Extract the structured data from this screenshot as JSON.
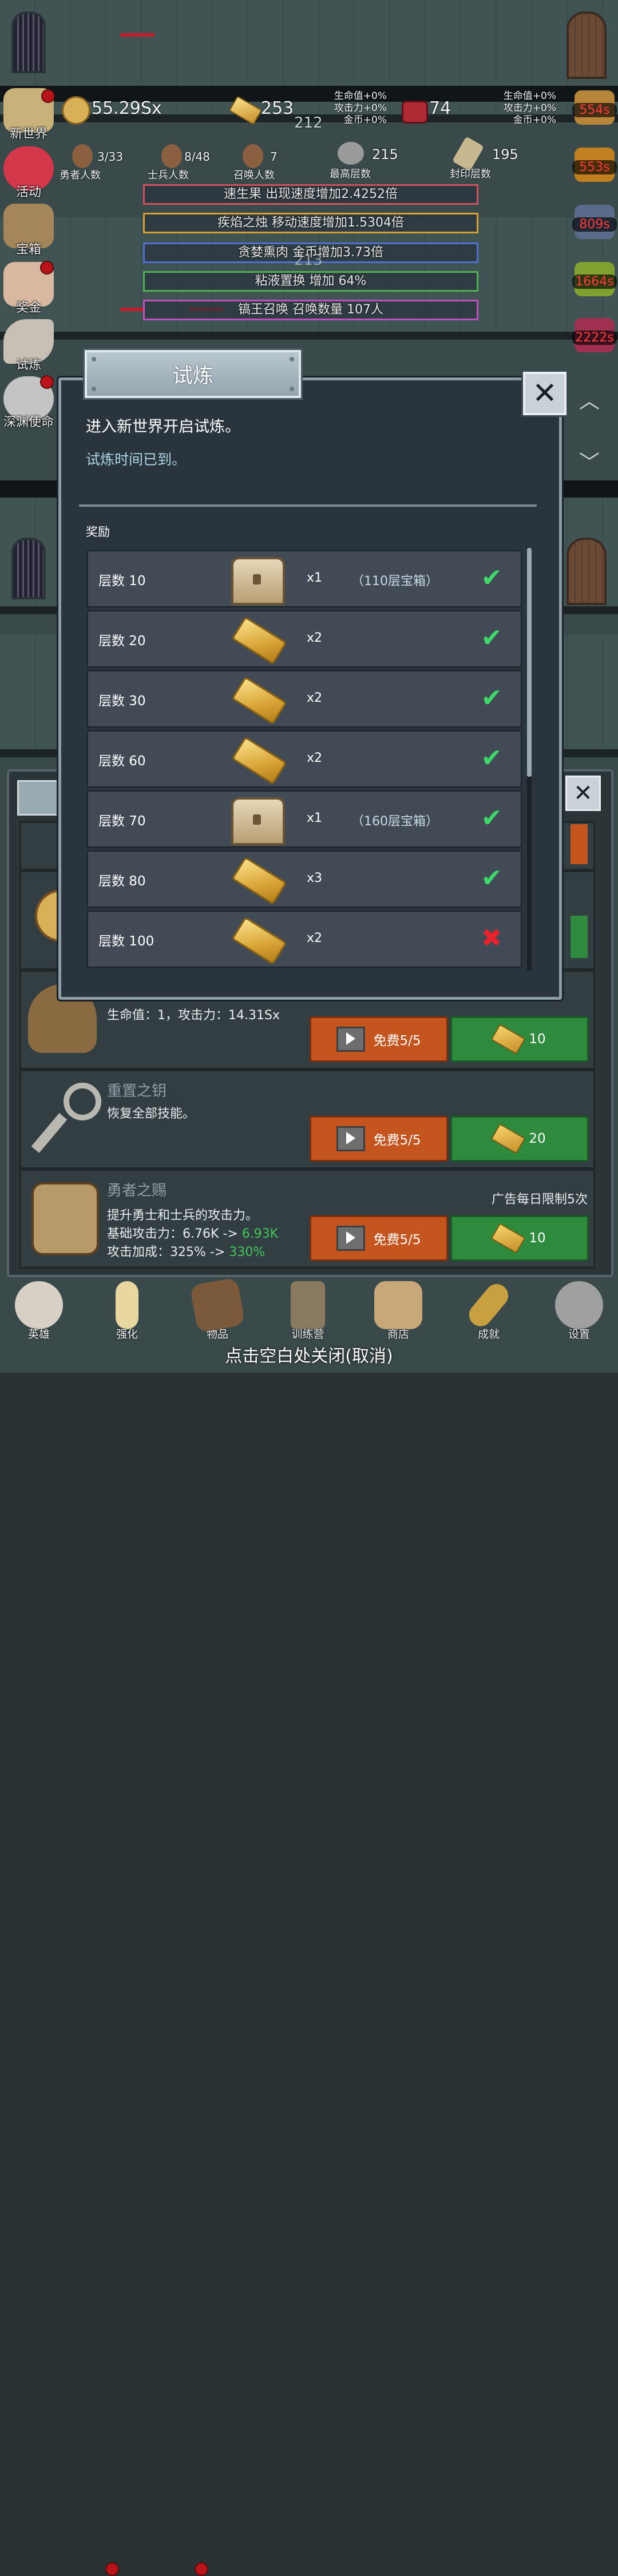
{
  "resources": {
    "coins": "55.29Sx",
    "gold_bars": "253",
    "gold_sub": "212",
    "gems": "74",
    "left_bonus": [
      "生命值+0%",
      "攻击力+0%",
      "金币+0%"
    ],
    "right_bonus": [
      "生命值+0%",
      "攻击力+0%",
      "金币+0%"
    ]
  },
  "stats": [
    {
      "value": "3/33",
      "label": "勇者人数"
    },
    {
      "value": "8/48",
      "label": "士兵人数"
    },
    {
      "value": "7",
      "label": "召唤人数"
    },
    {
      "value": "215",
      "label": "最高层数"
    },
    {
      "value": "195",
      "label": "封印层数"
    }
  ],
  "buffs": [
    {
      "text": "速生果 出现速度增加2.4252倍",
      "color": "#d05060"
    },
    {
      "text": "疾焰之烛 移动速度增加1.5304倍",
      "color": "#d8a030"
    },
    {
      "text": "贪婪熏肉 金币增加3.73倍",
      "color": "#5070d0"
    },
    {
      "text": "粘液置换 增加 64%",
      "color": "#50b050"
    },
    {
      "text": "镐王召唤 召唤数量 107人",
      "color": "#c050c0"
    }
  ],
  "floor_number": "213",
  "side_menu": [
    {
      "label": "新世界",
      "icon": "new-world-icon",
      "color": "#c9b27a"
    },
    {
      "label": "活动",
      "icon": "heart-icon",
      "color": "#d4364a"
    },
    {
      "label": "宝箱",
      "icon": "chest-icon",
      "color": "#a4865a"
    },
    {
      "label": "奖金",
      "icon": "envelope-icon",
      "color": "#d8b8a0"
    },
    {
      "label": "试炼",
      "icon": "feather-icon",
      "color": "#c8c0b4"
    },
    {
      "label": "深渊使命",
      "icon": "orb-icon",
      "color": "#c4c4c4"
    }
  ],
  "timers": [
    {
      "text": "554s",
      "color": "#b8863a"
    },
    {
      "text": "553s",
      "color": "#c08020"
    },
    {
      "text": "809s",
      "color": "#5a6a8a"
    },
    {
      "text": "1664s",
      "color": "#80a030"
    },
    {
      "text": "2222s",
      "color": "#a03050"
    }
  ],
  "modal": {
    "title": "试炼",
    "line1": "进入新世界开启试炼。",
    "line2": "试炼时间已到。",
    "reward_heading": "奖励",
    "close_symbol": "✕",
    "rewards": [
      {
        "layer": "层数 10",
        "item": "chest",
        "qty": "x1",
        "note": "（110层宝箱）",
        "claimed": true
      },
      {
        "layer": "层数 20",
        "item": "gold",
        "qty": "x2",
        "note": "",
        "claimed": true
      },
      {
        "layer": "层数 30",
        "item": "gold",
        "qty": "x2",
        "note": "",
        "claimed": true
      },
      {
        "layer": "层数 60",
        "item": "gold",
        "qty": "x2",
        "note": "",
        "claimed": true
      },
      {
        "layer": "层数 70",
        "item": "chest",
        "qty": "x1",
        "note": "（160层宝箱）",
        "claimed": true
      },
      {
        "layer": "层数 80",
        "item": "gold",
        "qty": "x3",
        "note": "",
        "claimed": true
      },
      {
        "layer": "层数 100",
        "item": "gold",
        "qty": "x2",
        "note": "",
        "claimed": false
      }
    ],
    "check_symbol": "✔",
    "cross_symbol": "✖"
  },
  "shop": {
    "row1": {
      "desc": "生命值：1，攻击力：14.31Sx",
      "ad_label": "免费5/5",
      "gold_label": "10"
    },
    "row2": {
      "title": "重置之钥",
      "desc": "恢复全部技能。",
      "ad_label": "免费5/5",
      "gold_label": "20"
    },
    "row3": {
      "title": "勇者之赐",
      "ad_limit": "广告每日限制5次",
      "desc": "提升勇士和士兵的攻击力。",
      "atk_base_label": "基础攻击力：6.76K ->",
      "atk_base_new": "6.93K",
      "atk_bonus_label": "攻击加成：325% ->",
      "atk_bonus_new": "330%",
      "ad_label": "免费5/5",
      "gold_label": "10"
    }
  },
  "nav": [
    {
      "label": "英雄",
      "icon": "skull-icon",
      "color": "#d8d0c4"
    },
    {
      "label": "强化",
      "icon": "candle-icon",
      "color": "#e8d8a0"
    },
    {
      "label": "物品",
      "icon": "book-icon",
      "color": "#7a5a3a"
    },
    {
      "label": "训练营",
      "icon": "lantern-icon",
      "color": "#8a7a60"
    },
    {
      "label": "商店",
      "icon": "mug-icon",
      "color": "#c8a878"
    },
    {
      "label": "成就",
      "icon": "key-icon",
      "color": "#c8a040"
    },
    {
      "label": "设置",
      "icon": "gear-icon",
      "color": "#a0a0a0"
    }
  ],
  "close_hint": "点击空白处关闭(取消)",
  "scroll_up": "︿",
  "scroll_down": "﹀"
}
